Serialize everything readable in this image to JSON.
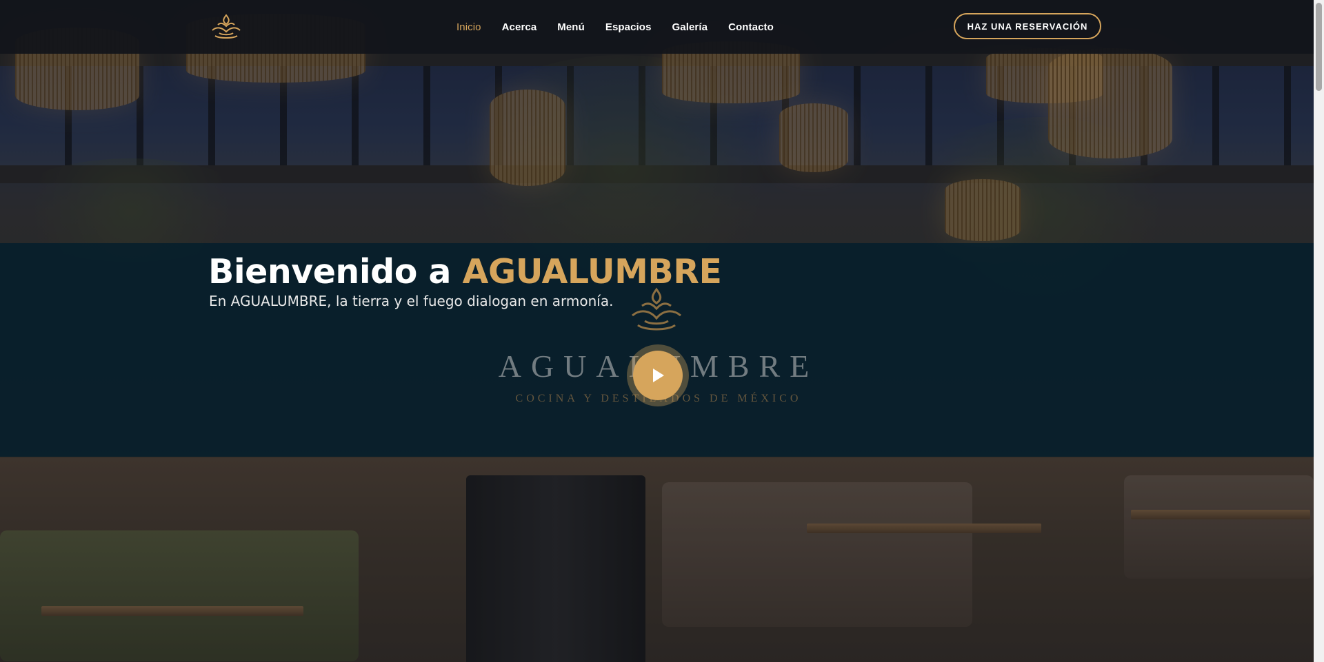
{
  "nav": {
    "links": [
      {
        "label": "Inicio",
        "active": true
      },
      {
        "label": "Acerca",
        "active": false
      },
      {
        "label": "Menú",
        "active": false
      },
      {
        "label": "Espacios",
        "active": false
      },
      {
        "label": "Galería",
        "active": false
      },
      {
        "label": "Contacto",
        "active": false
      }
    ],
    "reserve_label": "HAZ UNA RESERVACIÓN"
  },
  "hero": {
    "headline_prefix": "Bienvenido a ",
    "headline_brand": "AGUALUMBRE",
    "subtitle": "En AGUALUMBRE, la tierra y el fuego dialogan en armonía."
  },
  "video": {
    "wordmark": "AGUALUMBRE",
    "tagline": "COCINA Y DESTILADOS DE MÉXICO",
    "play_icon": "play-icon"
  },
  "colors": {
    "accent": "#d6a55c",
    "band": "#041e2c",
    "nav_bg": "#12141a"
  }
}
